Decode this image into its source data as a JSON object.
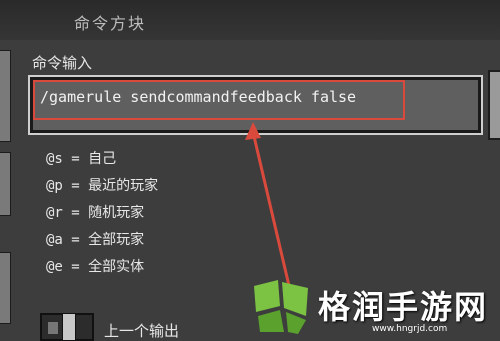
{
  "window": {
    "title": "命令方块"
  },
  "command_input": {
    "label": "命令输入",
    "value": "/gamerule sendcommandfeedback false"
  },
  "selectors": [
    {
      "key": "@s",
      "sep": " = ",
      "desc": "自己"
    },
    {
      "key": "@p",
      "sep": " = ",
      "desc": "最近的玩家"
    },
    {
      "key": "@r",
      "sep": " = ",
      "desc": "随机玩家"
    },
    {
      "key": "@a",
      "sep": " = ",
      "desc": "全部玩家"
    },
    {
      "key": "@e",
      "sep": " = ",
      "desc": "全部实体"
    }
  ],
  "previous_output": {
    "label": "上一个输出"
  },
  "watermark": {
    "site_name": "格润手游网",
    "url": "www.hngrjd.com",
    "color": "#7cc243"
  },
  "annotation": {
    "color": "#d94a3d"
  }
}
